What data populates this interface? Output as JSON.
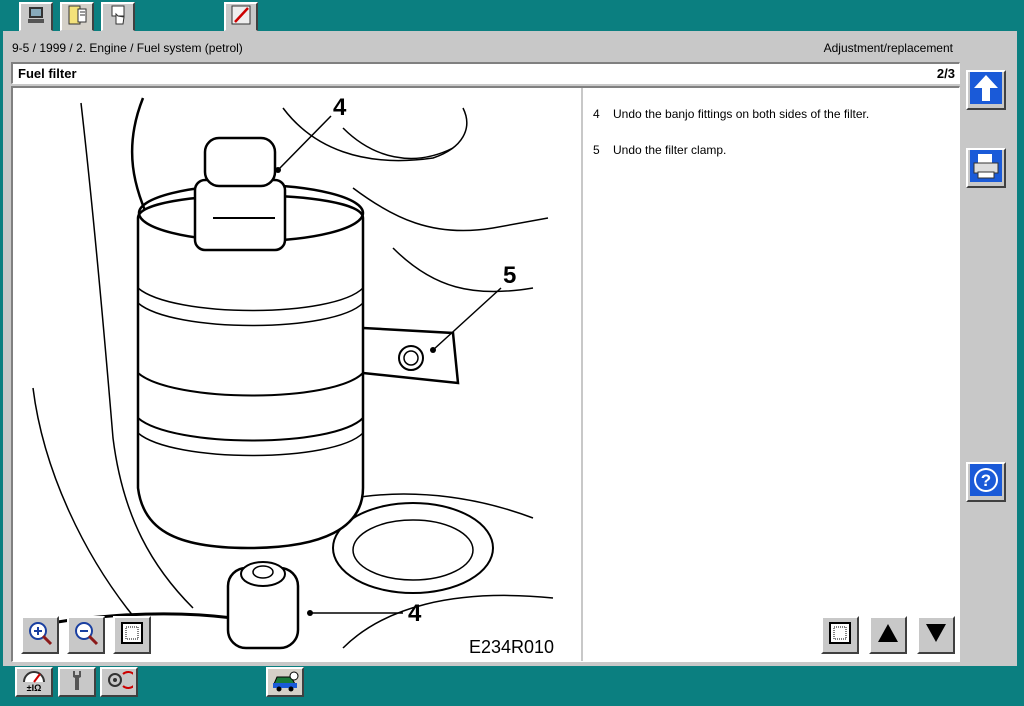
{
  "top_tabs": [
    {
      "icon": "computer-icon"
    },
    {
      "icon": "document-book-icon"
    },
    {
      "icon": "hand-pointer-icon"
    },
    {
      "icon": "pencil-icon"
    }
  ],
  "header": {
    "breadcrumb": "9-5 / 1999 / 2. Engine / Fuel system (petrol)",
    "section": "Adjustment/replacement"
  },
  "document": {
    "title": "Fuel filter",
    "page": "2/3"
  },
  "figure": {
    "code": "E234R010",
    "callouts": [
      "4",
      "5",
      "4"
    ]
  },
  "steps": [
    {
      "num": "4",
      "text": "Undo the banjo fittings on both sides of the filter."
    },
    {
      "num": "5",
      "text": "Undo the filter clamp."
    }
  ],
  "image_toolbar": [
    {
      "icon": "zoom-in-icon"
    },
    {
      "icon": "zoom-out-icon"
    },
    {
      "icon": "fit-window-icon"
    }
  ],
  "text_toolbar": [
    {
      "icon": "fit-window-icon"
    },
    {
      "icon": "arrow-up-icon"
    },
    {
      "icon": "arrow-down-icon"
    }
  ],
  "side_buttons": [
    {
      "icon": "up-arrow-icon"
    },
    {
      "icon": "printer-icon"
    },
    {
      "icon": "help-icon"
    }
  ],
  "bottom_tabs": [
    {
      "icon": "multimeter-icon"
    },
    {
      "icon": "wrench-icon"
    },
    {
      "icon": "diagnostic-icon"
    },
    {
      "icon": "car-icon"
    }
  ],
  "colors": {
    "background": "#0b7f80",
    "panel": "#c8c8c8",
    "accent_blue": "#1a5ad8"
  }
}
